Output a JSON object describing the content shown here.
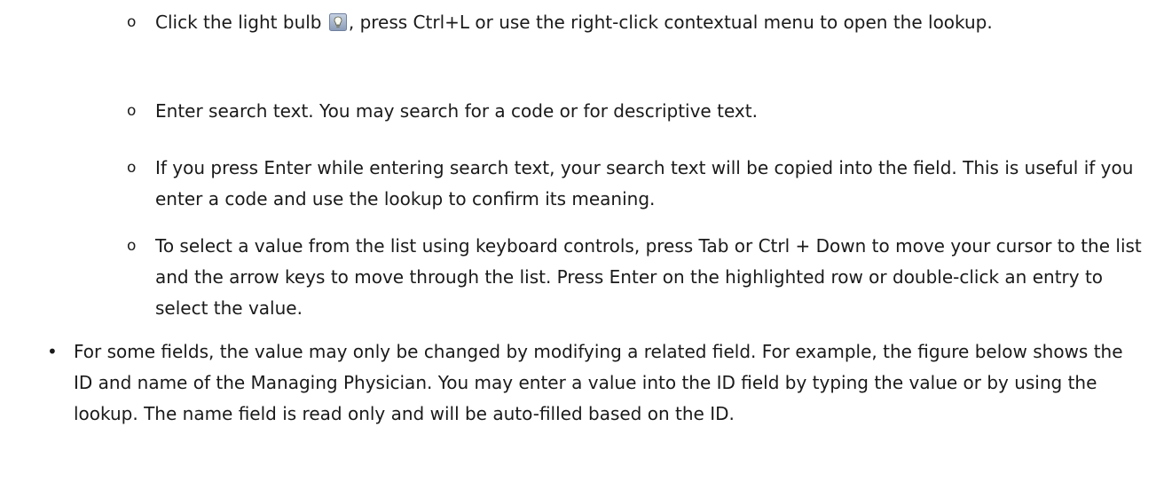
{
  "sub_items": [
    {
      "bullet": "o",
      "text_before_icon": "Click the light bulb ",
      "icon": "light-bulb-icon",
      "text_after_icon": ", press Ctrl+L or use the right-click contextual menu to open the lookup."
    },
    {
      "bullet": "o",
      "text": "Enter search text.  You may search for a code or for descriptive text."
    },
    {
      "bullet": "o",
      "text": "If you press Enter while entering search text, your search text will be copied into the field.  This is useful if you enter a code and use the lookup to confirm its meaning."
    },
    {
      "bullet": "o",
      "text": "To select a value from the list using keyboard controls, press Tab or Ctrl + Down to move your cursor to the list and the arrow keys to move through the list.  Press Enter on the highlighted row or double-click an entry to select the value."
    }
  ],
  "main_item": {
    "bullet": "•",
    "text": "For some fields, the value may only be changed by modifying a related field.  For example, the figure below shows the ID and name of the Managing Physician.  You may enter a value into the ID field by typing the value or by using the lookup.  The name field is read only and will be auto-filled based on the ID."
  }
}
